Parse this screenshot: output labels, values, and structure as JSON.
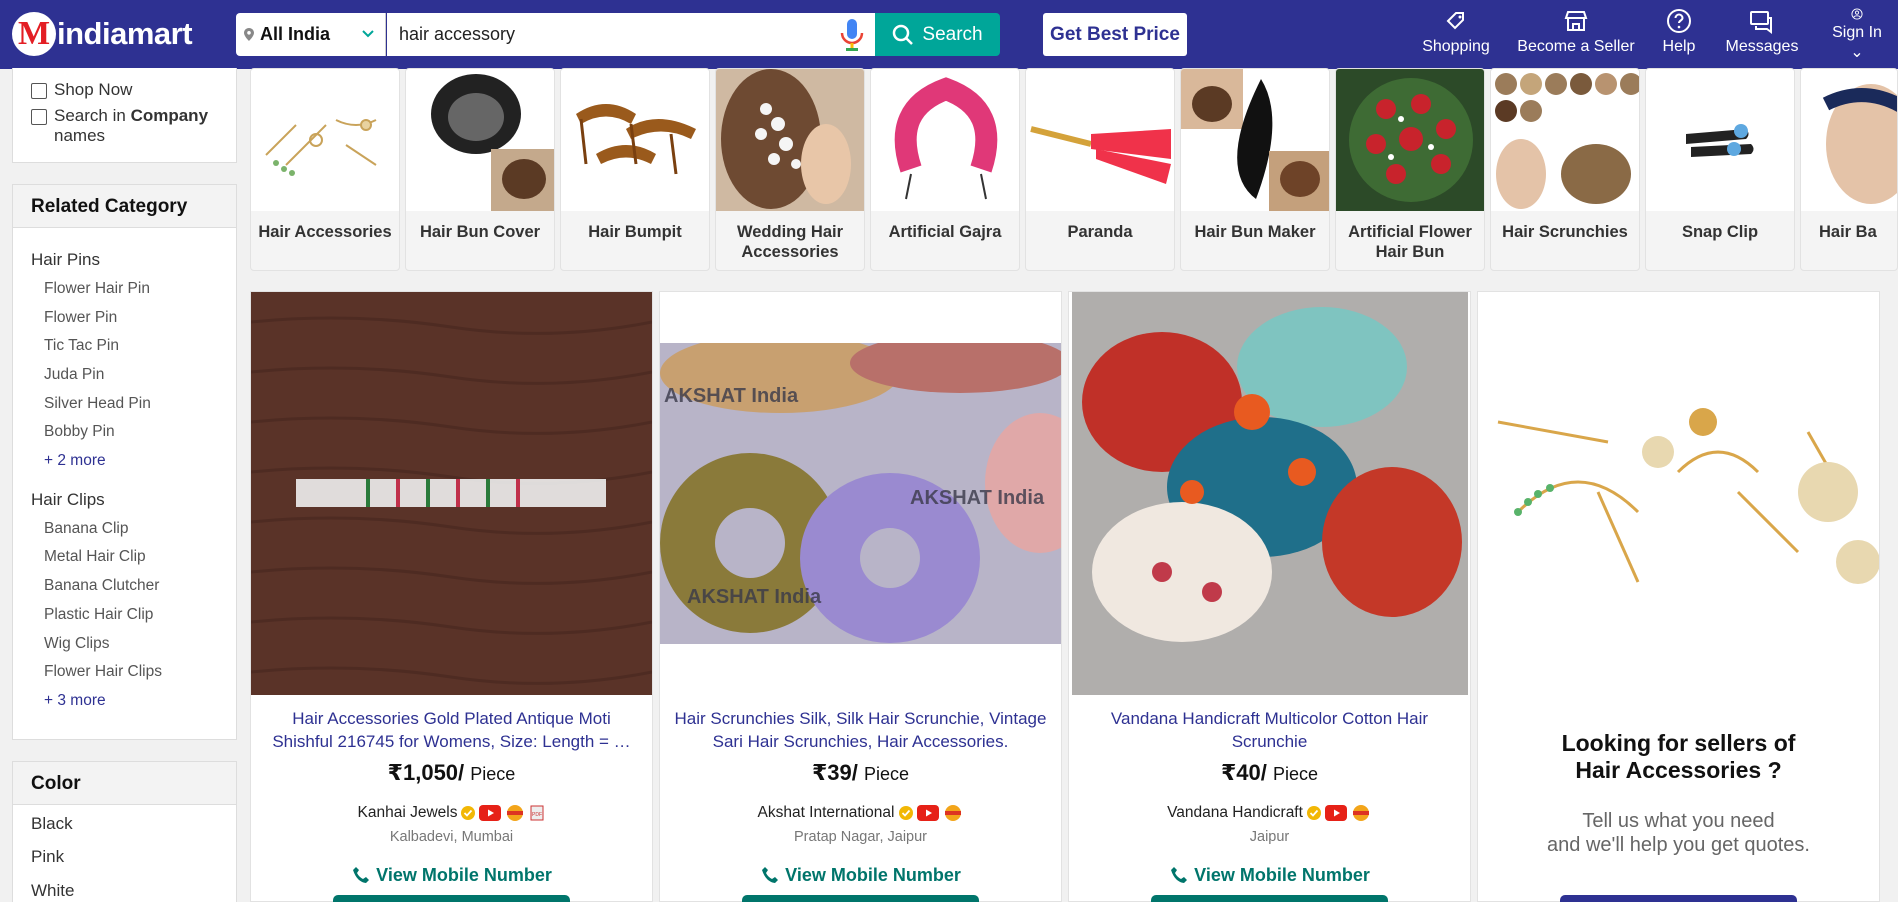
{
  "brand": {
    "name": "indiamart",
    "logo_letter": "M"
  },
  "header": {
    "location": "All India",
    "search_value": "hair accessory",
    "search_button": "Search",
    "best_price": "Get Best Price",
    "nav": [
      {
        "label": "Shopping",
        "icon": "tag-icon"
      },
      {
        "label": "Become a Seller",
        "icon": "store-icon"
      },
      {
        "label": "Help",
        "icon": "help-icon"
      },
      {
        "label": "Messages",
        "icon": "messages-icon"
      },
      {
        "label": "Sign In",
        "icon": "user-icon"
      }
    ]
  },
  "filters": {
    "shop_now": "Shop Now",
    "search_in": "Search in",
    "company": "Company",
    "names": "names"
  },
  "related": {
    "heading": "Related Category",
    "groups": [
      {
        "name": "Hair Pins",
        "items": [
          "Flower Hair Pin",
          "Flower Pin",
          "Tic Tac Pin",
          "Juda Pin",
          "Silver Head Pin",
          "Bobby Pin"
        ],
        "more": "+ 2 more"
      },
      {
        "name": "Hair Clips",
        "items": [
          "Banana Clip",
          "Metal Hair Clip",
          "Banana Clutcher",
          "Plastic Hair Clip",
          "Wig Clips",
          "Flower Hair Clips"
        ],
        "more": "+ 3 more"
      }
    ]
  },
  "color_filter": {
    "heading": "Color",
    "options": [
      "Black",
      "Pink",
      "White"
    ]
  },
  "categories": [
    "Hair Accessories",
    "Hair Bun Cover",
    "Hair Bumpit",
    "Wedding Hair Accessories",
    "Artificial Gajra",
    "Paranda",
    "Hair Bun Maker",
    "Artificial Flower Hair Bun",
    "Hair Scrunchies",
    "Snap Clip",
    "Hair Ba"
  ],
  "products": [
    {
      "title": "Hair Accessories Gold Plated Antique Moti Shishful 216745 for Womens, Size: Length = …",
      "price": "₹1,050/",
      "unit": "Piece",
      "seller": "Kanhai Jewels",
      "city": "Kalbadevi, Mumbai",
      "mobile": "View Mobile Number"
    },
    {
      "title": "Hair Scrunchies Silk, Silk Hair Scrunchie, Vintage Sari Hair Scrunchies, Hair Accessories.",
      "price": "₹39/",
      "unit": "Piece",
      "seller": "Akshat International",
      "city": "Pratap Nagar, Jaipur",
      "mobile": "View Mobile Number",
      "watermark": "AKSHAT India"
    },
    {
      "title": "Vandana Handicraft Multicolor Cotton Hair Scrunchie",
      "price": "₹40/",
      "unit": "Piece",
      "seller": "Vandana Handicraft",
      "city": "Jaipur",
      "mobile": "View Mobile Number"
    }
  ],
  "lead_form": {
    "line1": "Looking for sellers of",
    "line2": "Hair Accessories ?",
    "sub1": "Tell us what you need",
    "sub2": "and we'll help you get quotes."
  },
  "colors": {
    "header": "#2e3192",
    "search": "#00a699",
    "cta": "#00756b",
    "brand_red": "#e31e24"
  }
}
